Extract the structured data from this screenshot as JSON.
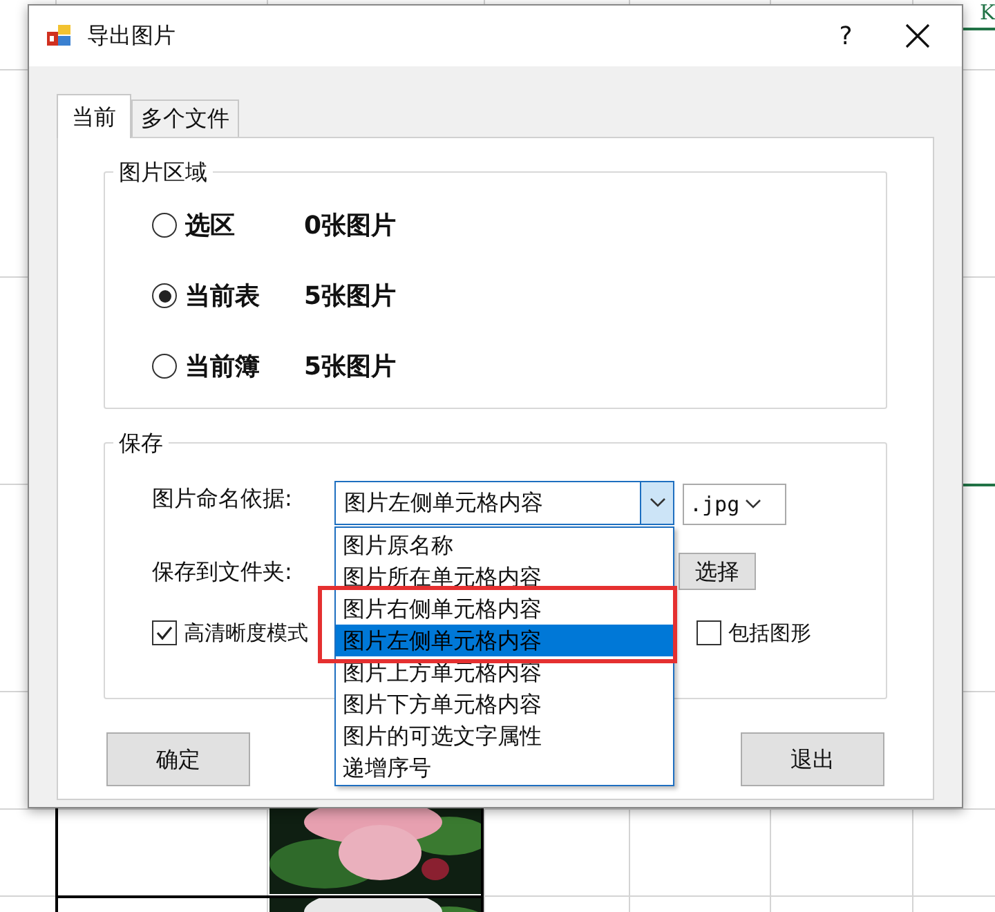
{
  "sheet": {
    "column_header": "K"
  },
  "window": {
    "title": "导出图片",
    "help": "?"
  },
  "tabs": [
    {
      "label": "当前",
      "selected": true
    },
    {
      "label": "多个文件",
      "selected": false
    }
  ],
  "area_group": {
    "title": "图片区域",
    "options": [
      {
        "label": "选区",
        "count": "0张图片",
        "selected": false
      },
      {
        "label": "当前表",
        "count": "5张图片",
        "selected": true
      },
      {
        "label": "当前簿",
        "count": "5张图片",
        "selected": false
      }
    ]
  },
  "save_group": {
    "title": "保存",
    "naming_label": "图片命名依据:",
    "naming_value": "图片左侧单元格内容",
    "format_value": ".jpg",
    "folder_label": "保存到文件夹:",
    "choose_button": "选择",
    "checkboxes": [
      {
        "label": "高清晰度模式",
        "checked": true
      },
      {
        "label": "包括图形",
        "checked": false
      }
    ],
    "dropdown": {
      "expanded": true,
      "options": [
        {
          "label": "图片原名称",
          "selected": false
        },
        {
          "label": "图片所在单元格内容",
          "selected": false
        },
        {
          "label": "图片右侧单元格内容",
          "selected": false
        },
        {
          "label": "图片左侧单元格内容",
          "selected": true
        },
        {
          "label": "图片上方单元格内容",
          "selected": false
        },
        {
          "label": "图片下方单元格内容",
          "selected": false
        },
        {
          "label": "图片的可选文字属性",
          "selected": false
        },
        {
          "label": "递增序号",
          "selected": false
        }
      ]
    }
  },
  "buttons": [
    "确定",
    "退出"
  ]
}
